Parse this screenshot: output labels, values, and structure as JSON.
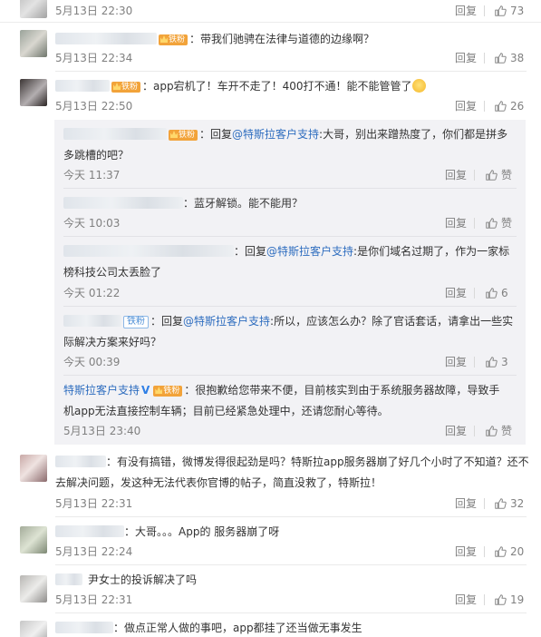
{
  "comments": [
    {
      "id": "c0",
      "name_blurred": true,
      "text": "",
      "time": "5月13日 22:30",
      "reply": "回复",
      "likes": "73"
    },
    {
      "id": "c1",
      "name_blurred": true,
      "badge": "铁粉",
      "text": "：带我们驰骋在法律与道德的边缘啊？",
      "time": "5月13日 22:34",
      "reply": "回复",
      "likes": "38"
    },
    {
      "id": "c2",
      "name_blurred": true,
      "badge": "铁粉",
      "text": "：app宕机了！车开不走了！400打不通！能不能管管了",
      "emoji": "grin-emoji",
      "time": "5月13日 22:50",
      "reply": "回复",
      "likes": "26"
    }
  ],
  "replies": [
    {
      "id": "r1",
      "badge": "铁粉",
      "prefix": "：回复",
      "mention": "@特斯拉客户支持",
      "line1": ":大哥，别出来蹭热度了，你们都是拼多",
      "line2": "多跳槽的吧？",
      "time": "今天 11:37",
      "reply": "回复",
      "likes": "赞"
    },
    {
      "id": "r2",
      "text": "：蓝牙解锁。能不能用？",
      "time": "今天 10:03",
      "reply": "回复",
      "likes": "赞"
    },
    {
      "id": "r3",
      "prefix": "：回复",
      "mention": "@特斯拉客户支持",
      "line1": ":是你们域名过期了，作为一家标",
      "line2": "榜科技公司太丢脸了",
      "time": "今天 01:22",
      "reply": "回复",
      "likes": "6"
    },
    {
      "id": "r4",
      "badge": "铁粉",
      "prefix": "：回复",
      "mention": "@特斯拉客户支持",
      "line1": ":所以，应该怎么办？除了官话套话，请拿出一些实",
      "line2": "际解决方案来好吗？",
      "time": "今天 00:39",
      "reply": "回复",
      "likes": "3"
    },
    {
      "id": "r5",
      "author": "特斯拉客户支持",
      "verified": "V",
      "badge": "铁粉",
      "line1": "：很抱歉给您带来不便，目前核实到由于系统服务器故障，导致手",
      "line2": "机app无法直接控制车辆；目前已经紧急处理中，还请您耐心等待。",
      "time": "5月13日 23:40",
      "reply": "回复",
      "likes": "赞"
    }
  ],
  "comments_after": [
    {
      "id": "c3",
      "line1": "：有没有搞错，微博发得很起劲是吗？特斯拉app服务器崩了好几个小时了不知道？还不",
      "line2": "去解决问题，发这种无法代表你官博的帖子，简直没救了，特斯拉！",
      "time": "5月13日 22:31",
      "reply": "回复",
      "likes": "32"
    },
    {
      "id": "c4",
      "text": "：大哥。。。App的 服务器崩了呀",
      "time": "5月13日 22:24",
      "reply": "回复",
      "likes": "20"
    },
    {
      "id": "c5",
      "text": "尹女士的投诉解决了吗",
      "time": "5月13日 22:31",
      "reply": "回复",
      "likes": "19"
    },
    {
      "id": "c6",
      "text": "：做点正常人做的事吧，app都挂了还当做无事发生"
    }
  ],
  "colors": {
    "link": "#eb7350",
    "mention": "#2e6dbf",
    "meta": "#808080",
    "badge": "#f2a33a",
    "panel": "#f2f2f5"
  }
}
